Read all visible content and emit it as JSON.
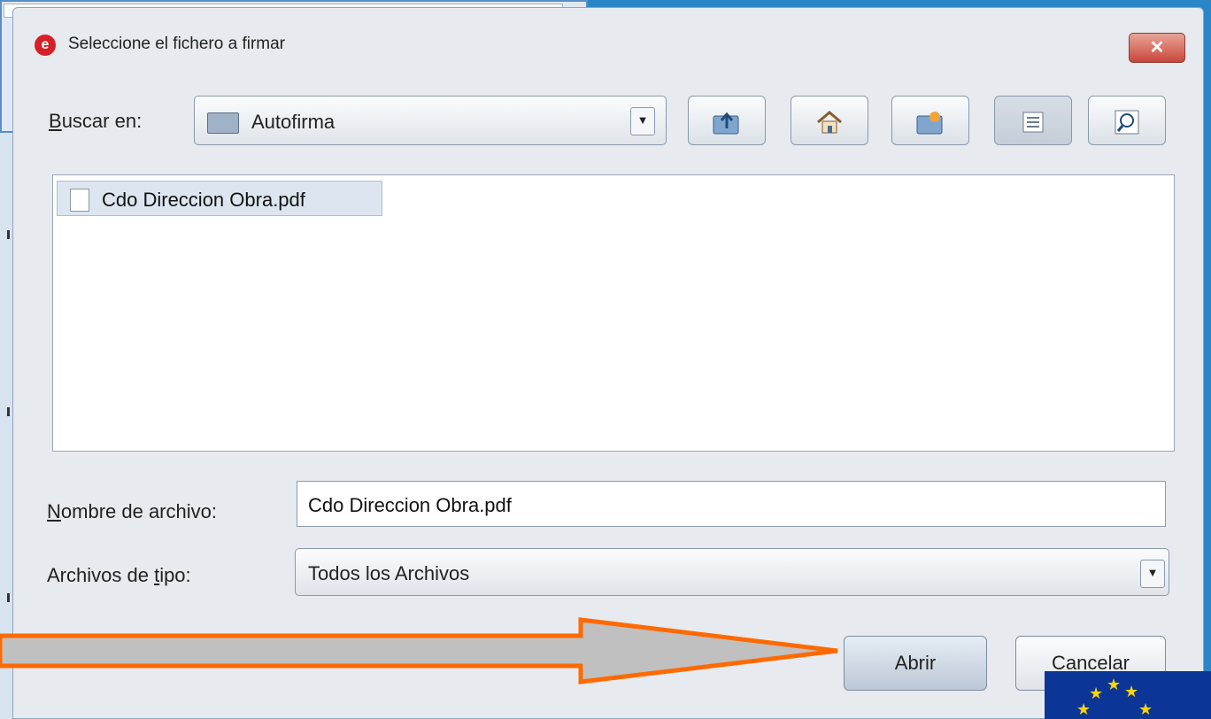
{
  "dialog": {
    "title": "Seleccione el fichero a firmar",
    "app_icon": "autofirma-logo",
    "close_icon": "close-icon"
  },
  "look_in": {
    "label_first_letter": "B",
    "label_rest": "uscar en:",
    "value": "Autofirma",
    "folder_icon": "folder-icon"
  },
  "toolbar": {
    "up_folder_icon": "up-one-level-icon",
    "home_icon": "home-icon",
    "new_folder_icon": "new-folder-icon",
    "list_view_icon": "list-view-icon",
    "details_view_icon": "details-view-icon"
  },
  "file_list": [
    {
      "name": "Cdo Direccion Obra.pdf",
      "icon": "document-icon",
      "selected": true
    }
  ],
  "file_name": {
    "label_first_letter": "N",
    "label_rest": "ombre de archivo:",
    "value": "Cdo Direccion Obra.pdf"
  },
  "file_type": {
    "label_prefix": "Archivos de ",
    "label_underlined": "t",
    "label_suffix": "ipo:",
    "value": "Todos los Archivos"
  },
  "buttons": {
    "open_label": "Abrir",
    "cancel_label": "Cancelar"
  },
  "annotation": {
    "arrow_fill": "#c0c0c0",
    "arrow_stroke": "#ff6a00"
  },
  "colors": {
    "desktop": "#2b86c7",
    "close_button": "#c9473a",
    "eu_flag_blue": "#0b3596",
    "eu_star": "#ffd400"
  }
}
